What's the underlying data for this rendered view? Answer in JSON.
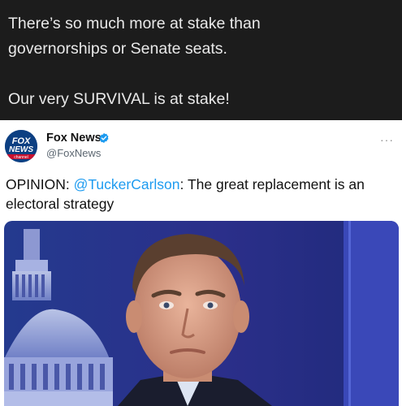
{
  "post": {
    "lines": [
      "There’s so much more at stake than",
      "governorships or Senate seats.",
      "Our very SURVIVAL is at stake!"
    ]
  },
  "tweet": {
    "author_name": "Fox News",
    "author_handle": "@FoxNews",
    "avatar_text_1": "FOX",
    "avatar_text_2": "NEWS",
    "avatar_text_3": "channel",
    "more_label": "···",
    "text_prefix": "OPINION: ",
    "mention": "@TuckerCarlson",
    "text_suffix": ": The great replacement is an electoral strategy"
  },
  "colors": {
    "background": "#1c1c1c",
    "accent": "#1d9bf0",
    "verified": "#1d9bf0",
    "fox_blue": "#0c3f82"
  },
  "icons": {
    "verified": "verified-badge-icon",
    "more": "more-options-icon"
  }
}
